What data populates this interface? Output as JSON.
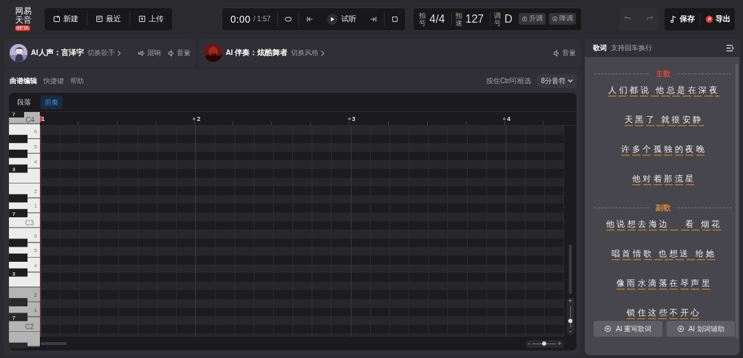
{
  "logo": {
    "line_1": "网易",
    "line_2": "天音",
    "badge": "BETA"
  },
  "file_buttons": [
    {
      "kind": "new",
      "label": "新建"
    },
    {
      "kind": "recent",
      "label": "最近"
    },
    {
      "kind": "upload",
      "label": "上传"
    }
  ],
  "transport": {
    "time": "0:00",
    "duration": "/ 1:57",
    "play_label": "试听"
  },
  "song_info": [
    {
      "label": "拍号",
      "value": "4/4"
    },
    {
      "label": "拍速",
      "value": "127"
    },
    {
      "label": "调号",
      "value": "D"
    }
  ],
  "key_buttons": [
    {
      "kind": "up",
      "label": "升调"
    },
    {
      "kind": "down",
      "label": "降调"
    }
  ],
  "history": [
    {
      "kind": "undo",
      "disabled": true
    },
    {
      "kind": "redo",
      "disabled": true
    }
  ],
  "actions": [
    {
      "kind": "save",
      "label": "保存"
    },
    {
      "kind": "export",
      "label": "导出"
    }
  ],
  "voice_card": {
    "title": "AI人声：言泽宇",
    "switch_label": "切换歌手",
    "tools": [
      {
        "kind": "reverb",
        "label": "混响"
      },
      {
        "kind": "volume",
        "label": "音量"
      }
    ]
  },
  "accompaniment_card": {
    "title": "AI 伴奏：炫酷舞者",
    "switch_label": "切换风格",
    "tools": [
      {
        "kind": "volume",
        "label": "音量"
      }
    ]
  },
  "editor": {
    "tabs": [
      {
        "label": "曲谱编辑",
        "selected": true
      },
      {
        "label": "快捷键",
        "selected": false
      },
      {
        "label": "帮助",
        "selected": false
      }
    ],
    "hint": "按住Ctrl可框选",
    "note_length": "8分音符",
    "section_label": "段落",
    "segments": [
      {
        "label": "前奏",
        "selected": true
      }
    ],
    "measures": [
      "1",
      "2",
      "3",
      "4"
    ],
    "keys": [
      {
        "kind": "black",
        "label": "7",
        "shaded": false
      },
      {
        "kind": "white",
        "label": "C4",
        "shaded": true
      },
      {
        "kind": "white",
        "label": "6",
        "shaded": false
      },
      {
        "kind": "black",
        "shaded": false
      },
      {
        "kind": "white",
        "label": "5",
        "shaded": false
      },
      {
        "kind": "black",
        "shaded": false
      },
      {
        "kind": "white",
        "label": "4",
        "shaded": false
      },
      {
        "kind": "black",
        "label": "3",
        "shaded": false
      },
      {
        "kind": "white",
        "shaded": false
      },
      {
        "kind": "white",
        "label": "2",
        "shaded": false
      },
      {
        "kind": "black",
        "shaded": false
      },
      {
        "kind": "white",
        "label": "1",
        "shaded": false
      },
      {
        "kind": "black",
        "label": "7",
        "shaded": false
      },
      {
        "kind": "white",
        "label": "C3",
        "shaded": false
      },
      {
        "kind": "white",
        "label": "6",
        "shaded": false
      },
      {
        "kind": "black",
        "shaded": false
      },
      {
        "kind": "white",
        "label": "5",
        "shaded": false
      },
      {
        "kind": "black",
        "shaded": false
      },
      {
        "kind": "white",
        "label": "4",
        "shaded": false
      },
      {
        "kind": "black",
        "label": "3",
        "shaded": false
      },
      {
        "kind": "white",
        "shaded": false
      },
      {
        "kind": "white",
        "label": "2",
        "shaded": true
      },
      {
        "kind": "black",
        "shaded": true
      },
      {
        "kind": "white",
        "label": "1",
        "shaded": true
      },
      {
        "kind": "black",
        "label": "7",
        "shaded": true
      },
      {
        "kind": "white",
        "label": "C2",
        "shaded": true
      },
      {
        "kind": "white",
        "shaded": true
      },
      {
        "kind": "black",
        "shaded": true
      }
    ],
    "vertical_zoom": {
      "plus": "+",
      "minus": "-",
      "level": 0.3
    },
    "horizontal_zoom": {
      "minus": "-",
      "plus": "+",
      "level": 0.5
    }
  },
  "lyrics": {
    "title": "歌词",
    "hint": "支持回车换行",
    "sections": [
      {
        "name": "主歌",
        "color": "#e0453a",
        "lines": [
          "人们都说 他总是在深夜",
          "天黑了 就很安静",
          "许多个孤独的夜晚",
          "他对着那流星"
        ]
      },
      {
        "name": "副歌",
        "color": "#d08a3a",
        "lines": [
          "他说想去海边　 看 烟花",
          "唱首情歌 也想送 给她",
          "像雨水滴落在琴声里",
          "锁住这些不开心"
        ]
      }
    ],
    "buttons": [
      "AI 重写歌词",
      "AI 划词辅助"
    ]
  }
}
